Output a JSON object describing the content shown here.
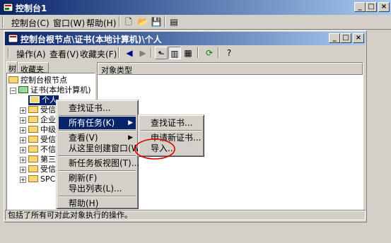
{
  "window": {
    "title": "控制台1",
    "minimize": "_",
    "maximize": "□",
    "close": "×"
  },
  "menubar": {
    "items": [
      "控制台(C)",
      "窗口(W)",
      "帮助(H)"
    ]
  },
  "child": {
    "title": "控制台根节点\\证书(本地计算机)\\个人"
  },
  "action_bar": {
    "items": [
      "操作(A)",
      "查看(V)",
      "收藏夹(F)"
    ]
  },
  "tabs": [
    "树",
    "收藏夹"
  ],
  "tree": {
    "root": "控制台根节点",
    "cert_node": "证书(本地计算机)",
    "selected": "个人",
    "partial": [
      "受信",
      "企业",
      "中级",
      "受信",
      "不信",
      "第三",
      "受信",
      "SPC"
    ]
  },
  "right_pane": {
    "column": "对象类型"
  },
  "context_menu": {
    "items": [
      "查找证书...",
      "所有任务(K)",
      "查看(V)",
      "从这里创建窗口(W)",
      "新任务板视图(T)...",
      "刷新(F)",
      "导出列表(L)...",
      "帮助(H)"
    ]
  },
  "submenu": {
    "items": [
      "查找证书...",
      "申请新证书...",
      "导入..."
    ]
  },
  "status": "包括了所有可对此对象执行的操作。",
  "colors": {
    "title_start": "#0a246a",
    "title_end": "#a6caf0",
    "highlight": "#0a246a",
    "annotation": "#e00000"
  }
}
